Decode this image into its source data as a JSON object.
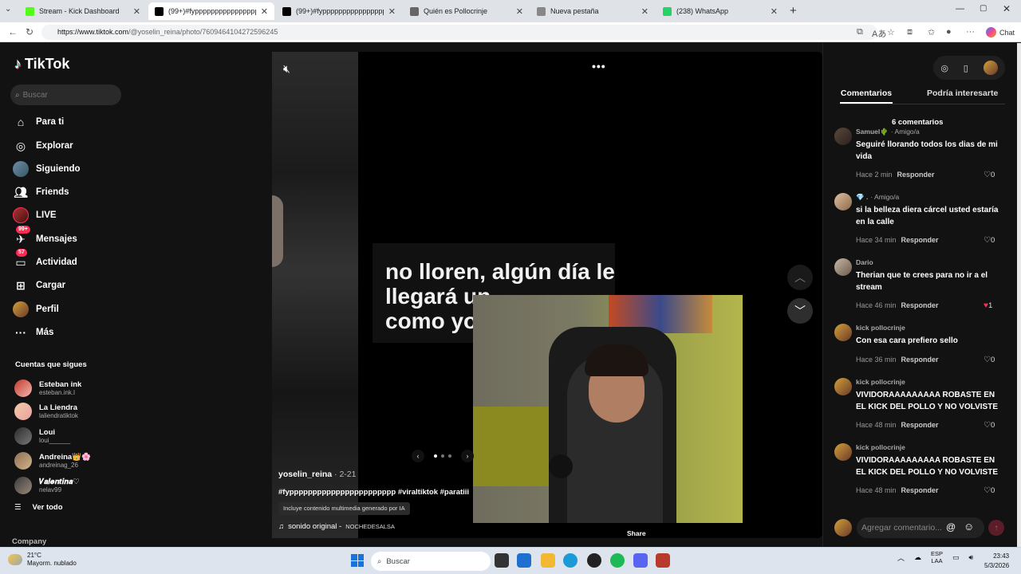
{
  "browser": {
    "tabs": [
      {
        "title": "Stream - Kick Dashboard",
        "icon": "kick-icon",
        "color": "#53fc18",
        "active": false
      },
      {
        "title": "(99+)#fyppppppppppppppppppppppp",
        "icon": "tiktok-icon",
        "color": "#000000",
        "active": true
      },
      {
        "title": "(99+)#fyppppppppppppppppppppppp",
        "icon": "tiktok-icon",
        "color": "#000000",
        "active": false
      },
      {
        "title": "Quién es Pollocrinje",
        "icon": "globe-icon",
        "color": "#666666",
        "active": false
      },
      {
        "title": "Nueva pestaña",
        "icon": "newtab-icon",
        "color": "#888888",
        "active": false
      },
      {
        "title": "(238) WhatsApp",
        "icon": "whatsapp-icon",
        "color": "#25d366",
        "active": false
      }
    ],
    "url_host": "https://www.tiktok.com",
    "url_path": "/@yoselin_reina/photo/7609464104272596245",
    "chat_label": "Chat"
  },
  "sidebar": {
    "logo": "TikTok",
    "search_placeholder": "Buscar",
    "nav": [
      {
        "label": "Para ti",
        "icon": "home-icon"
      },
      {
        "label": "Explorar",
        "icon": "compass-icon"
      },
      {
        "label": "Siguiendo",
        "icon": "following-avatar-icon"
      },
      {
        "label": "Friends",
        "icon": "friends-icon"
      },
      {
        "label": "LIVE",
        "icon": "live-icon"
      },
      {
        "label": "Mensajes",
        "icon": "messages-icon",
        "badge": "99+"
      },
      {
        "label": "Actividad",
        "icon": "activity-icon",
        "badge": "57"
      },
      {
        "label": "Cargar",
        "icon": "upload-icon"
      },
      {
        "label": "Perfil",
        "icon": "profile-avatar-icon"
      },
      {
        "label": "Más",
        "icon": "more-icon"
      }
    ],
    "following_title": "Cuentas que sigues",
    "accounts": [
      {
        "name": "Esteban ink",
        "handle": "esteban.ink.l"
      },
      {
        "name": "La Liendra",
        "handle": "laliendratiktok"
      },
      {
        "name": "Loui",
        "handle": "loui______"
      },
      {
        "name": "Andreina👑🌸",
        "handle": "andreinag_26"
      },
      {
        "name": "𝑽𝒂𝒍𝒆𝒏𝒕𝒊𝒏𝒂♡",
        "handle": "nelav99"
      }
    ],
    "see_all": "Ver todo",
    "company": "Company"
  },
  "video": {
    "caption": [
      "no lloren, algún día le",
      "llegará un",
      "como yo"
    ],
    "author": "yoselin_reina",
    "date": "· 2-21",
    "hashtags": "#fyppppppppppppppppppppppp #viraltiktok #paratiii",
    "ai_badge": "Incluye contenido multimedia generado por IA",
    "sound": "sonido original -",
    "sound_owner": "NOCHEDESALSA",
    "share": "Share"
  },
  "comments_panel": {
    "tab_comments": "Comentarios",
    "tab_interest": "Podría interesarte",
    "count": "6 comentarios",
    "reply_label": "Responder",
    "input_placeholder": "Agregar comentario...",
    "items": [
      {
        "user": "Samuel🌵",
        "tag": "· Amigo/a",
        "text": "Seguiré llorando todos los dias de mi vida",
        "time": "Hace 2 min",
        "likes": "0",
        "liked": false
      },
      {
        "user": "💎 .",
        "tag": "· Amigo/a",
        "text": "si la belleza diera cárcel usted estaría en la calle",
        "time": "Hace 34 min",
        "likes": "0",
        "liked": false
      },
      {
        "user": "Dario",
        "tag": "",
        "text": "Therian que te crees para no ir a el stream",
        "time": "Hace 46 min",
        "likes": "1",
        "liked": true
      },
      {
        "user": "kick pollocrinje",
        "tag": "",
        "text": "Con esa cara prefiero sello",
        "time": "Hace 36 min",
        "likes": "0",
        "liked": false
      },
      {
        "user": "kick pollocrinje",
        "tag": "",
        "text": "VIVIDORAAAAAAAAA ROBASTE EN EL KICK DEL POLLO Y NO VOLVISTE",
        "time": "Hace 48 min",
        "likes": "0",
        "liked": false
      },
      {
        "user": "kick pollocrinje",
        "tag": "",
        "text": "VIVIDORAAAAAAAAA ROBASTE EN EL KICK DEL POLLO Y NO VOLVISTE",
        "time": "Hace 48 min",
        "likes": "0",
        "liked": false
      }
    ]
  },
  "taskbar": {
    "weather_temp": "21°C",
    "weather_desc": "Mayorm. nublado",
    "search": "Buscar",
    "lang_top": "ESP",
    "lang_bottom": "LAA",
    "time": "23:43",
    "date": "5/3/2026"
  }
}
